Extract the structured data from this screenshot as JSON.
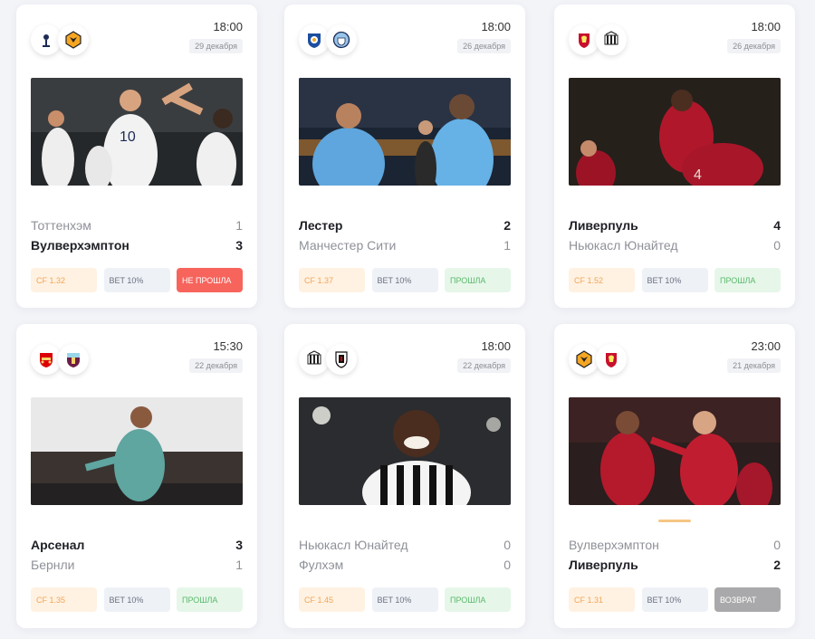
{
  "matches": [
    {
      "time": "18:00",
      "date": "29 декабря",
      "home": {
        "name": "Тоттенхэм",
        "score": "1",
        "logo": "tottenham-logo"
      },
      "away": {
        "name": "Вулверхэмптон",
        "score": "3",
        "logo": "wolves-logo"
      },
      "cf": "CF 1.32",
      "bet": "BET 10%",
      "result": "НЕ ПРОШЛА",
      "result_type": "lose"
    },
    {
      "time": "18:00",
      "date": "26 декабря",
      "home": {
        "name": "Лестер",
        "score": "2",
        "logo": "leicester-logo"
      },
      "away": {
        "name": "Манчестер Сити",
        "score": "1",
        "logo": "man-city-logo"
      },
      "cf": "CF 1.37",
      "bet": "BET 10%",
      "result": "ПРОШЛА",
      "result_type": "win"
    },
    {
      "time": "18:00",
      "date": "26 декабря",
      "home": {
        "name": "Ливерпуль",
        "score": "4",
        "logo": "liverpool-logo"
      },
      "away": {
        "name": "Ньюкасл Юнайтед",
        "score": "0",
        "logo": "newcastle-logo"
      },
      "cf": "CF 1.52",
      "bet": "BET 10%",
      "result": "ПРОШЛА",
      "result_type": "win"
    },
    {
      "time": "15:30",
      "date": "22 декабря",
      "home": {
        "name": "Арсенал",
        "score": "3",
        "logo": "arsenal-logo"
      },
      "away": {
        "name": "Бернли",
        "score": "1",
        "logo": "burnley-logo"
      },
      "cf": "CF 1.35",
      "bet": "BET 10%",
      "result": "ПРОШЛА",
      "result_type": "win"
    },
    {
      "time": "18:00",
      "date": "22 декабря",
      "home": {
        "name": "Ньюкасл Юнайтед",
        "score": "0",
        "logo": "newcastle-logo"
      },
      "away": {
        "name": "Фулхэм",
        "score": "0",
        "logo": "fulham-logo"
      },
      "cf": "CF 1.45",
      "bet": "BET 10%",
      "result": "ПРОШЛА",
      "result_type": "win"
    },
    {
      "time": "23:00",
      "date": "21 декабря",
      "home": {
        "name": "Вулверхэмптон",
        "score": "0",
        "logo": "wolves-logo"
      },
      "away": {
        "name": "Ливерпуль",
        "score": "2",
        "logo": "liverpool-logo"
      },
      "cf": "CF 1.31",
      "bet": "BET 10%",
      "result": "ВОЗВРАТ",
      "result_type": "refund"
    }
  ]
}
